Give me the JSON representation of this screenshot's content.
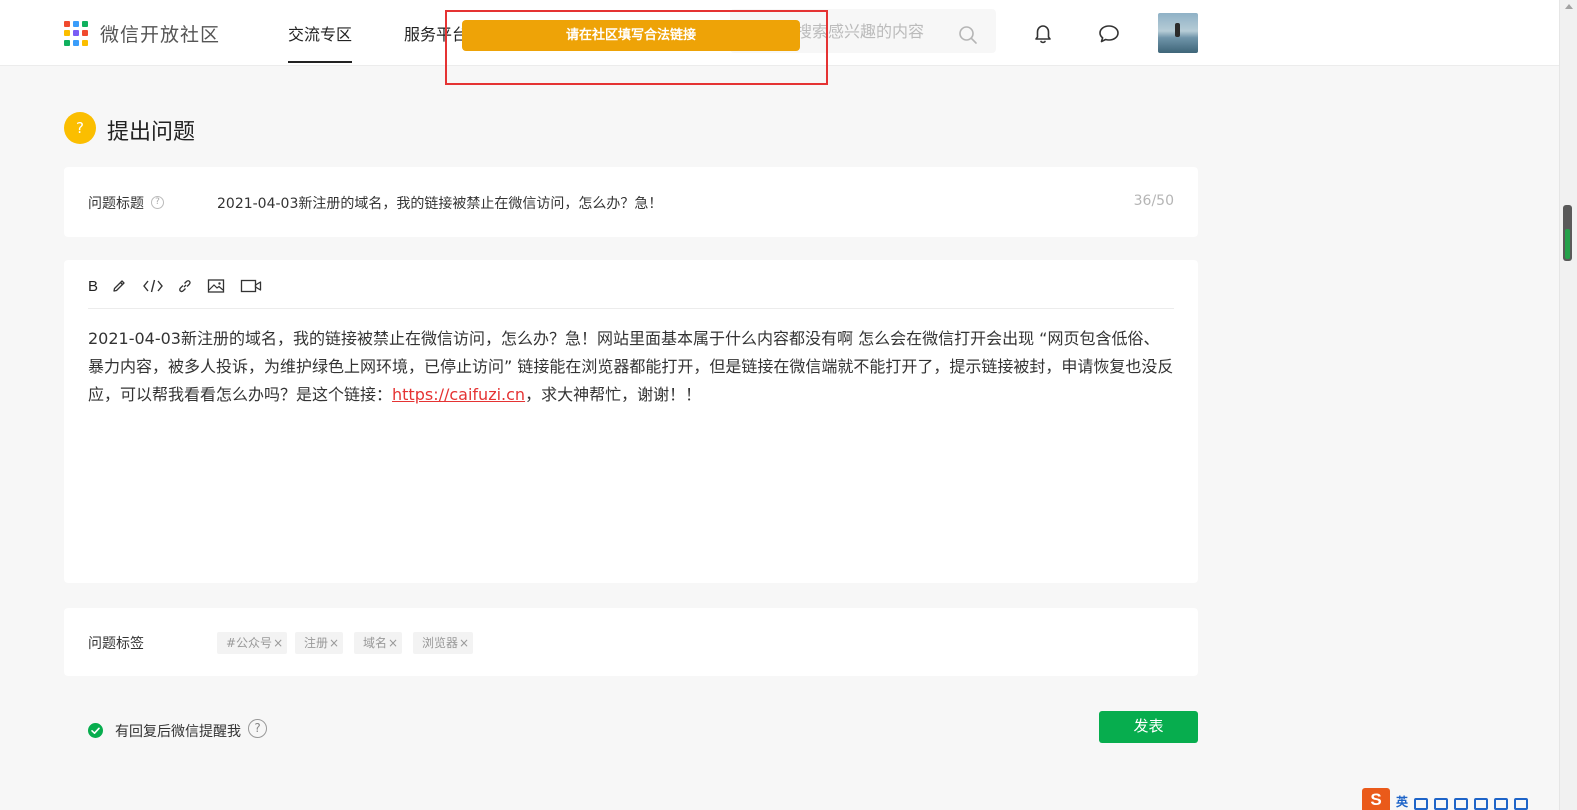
{
  "header": {
    "logo_text": "微信开放社区",
    "logo_colors": [
      "#f04a2f",
      "#3a9dfa",
      "#10b05e",
      "#fbbe00",
      "#7a5cf5",
      "#f04a2f",
      "#10b05e",
      "#3a9dfa",
      "#fbbe00"
    ],
    "nav": {
      "active": "交流专区",
      "second": "服务平台"
    },
    "search_placeholder": "搜索感兴趣的内容",
    "icons": [
      "search-icon",
      "bell-icon",
      "chat-icon"
    ]
  },
  "toast": {
    "message": "请在社区填写合法链接",
    "color": "#eea307",
    "highlight_color": "#e53333"
  },
  "page": {
    "badge": "?",
    "title": "提出问题"
  },
  "title_field": {
    "label": "问题标题",
    "help": "?",
    "value": "2021-04-03新注册的域名，我的链接被禁止在微信访问，怎么办？急！",
    "counter": "36/50"
  },
  "editor": {
    "toolbar": {
      "bold": "B",
      "icons": [
        "pen-icon",
        "code-icon",
        "link-icon",
        "image-icon",
        "video-icon"
      ]
    },
    "content_before": "2021-04-03新注册的域名，我的链接被禁止在微信访问，怎么办？急！网站里面基本属于什么内容都没有啊 怎么会在微信打开会出现 “网页包含低俗、暴力内容，被多人投诉，为维护绿色上网环境，已停止访问” 链接能在浏览器都能打开，但是链接在微信端就不能打开了，提示链接被封，申请恢复也没反应，可以帮我看看怎么办吗？是这个链接：",
    "content_link": "https://caifuzi.cn",
    "content_after": "，求大神帮忙，谢谢！！"
  },
  "tags": {
    "label": "问题标签",
    "items": [
      "#公众号",
      "注册",
      "域名",
      "浏览器"
    ],
    "remove_symbol": "×"
  },
  "footer": {
    "remind_label": "有回复后微信提醒我",
    "help": "?",
    "publish_label": "发表",
    "accent": "#07ad4e"
  },
  "ime": {
    "logo": "S",
    "lang": "英"
  }
}
